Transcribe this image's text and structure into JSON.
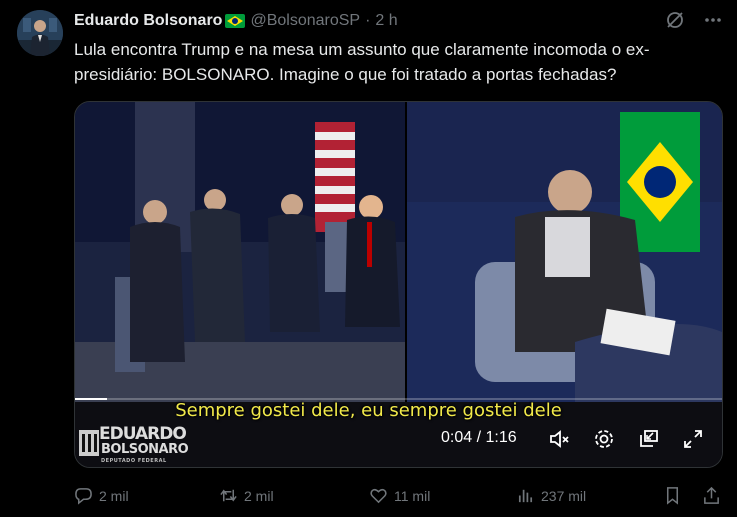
{
  "author": {
    "name": "Eduardo Bolsonaro",
    "handle": "@BolsonaroSP",
    "separator": "·",
    "time": "2 h"
  },
  "tweet": {
    "text": "Lula encontra Trump e na mesa um assunto que claramente incomoda o ex-presidiário: BOLSONARO. Imagine o que foi tratado a portas fechadas?"
  },
  "video": {
    "subtitle": "Sempre gostei dele, eu sempre gostei dele",
    "time_display": "0:04 / 1:16",
    "progress": 0.05,
    "watermark": {
      "line1": "EDUARDO",
      "line2": "BOLSONARO",
      "line3": "DEPUTADO FEDERAL"
    }
  },
  "actions": {
    "replies": "2 mil",
    "reposts": "2 mil",
    "likes": "11 mil",
    "views": "237 mil"
  },
  "icons": [
    "grok-icon",
    "more-icon",
    "volume-muted-icon",
    "settings-icon",
    "pip-icon",
    "fullscreen-icon",
    "reply-icon",
    "repost-icon",
    "like-icon",
    "views-icon",
    "bookmark-icon",
    "share-icon"
  ],
  "colors": {
    "background": "#000000",
    "text": "#e7e9ea",
    "muted": "#71767b",
    "subtitle": "#f1e94a",
    "flag_green": "#009c3b",
    "flag_yellow": "#ffdf00"
  }
}
